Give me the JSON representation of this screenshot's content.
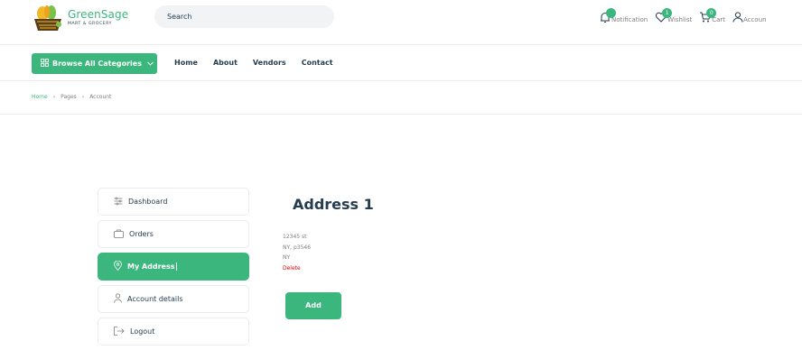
{
  "brand": {
    "name": "GreenSage",
    "tagline": "MART & GROCERY"
  },
  "search": {
    "placeholder": "Search"
  },
  "header_actions": [
    {
      "label": "Notification",
      "icon": "bell-icon"
    },
    {
      "label": "Wishlist",
      "badge": "1",
      "icon": "heart-icon"
    },
    {
      "label": "Cart",
      "badge": "0",
      "icon": "cart-icon"
    },
    {
      "label": "Accoun",
      "icon": "user-icon"
    }
  ],
  "nav": {
    "browse_label": "Browse All Categories",
    "links": [
      "Home",
      "About",
      "Vendors",
      "Contact"
    ]
  },
  "breadcrumb": [
    "Home",
    "Pages",
    "Account"
  ],
  "sidebar": {
    "items": [
      {
        "label": "Dashboard",
        "icon": "sliders-icon"
      },
      {
        "label": "Orders",
        "icon": "bag-icon"
      },
      {
        "label": "My Address",
        "icon": "location-pin-icon",
        "active": true
      },
      {
        "label": "Account details",
        "icon": "user-icon"
      },
      {
        "label": "Logout",
        "icon": "logout-icon"
      }
    ]
  },
  "address": {
    "title": "Address 1",
    "lines": [
      "12345 st",
      "NY, p3546",
      "NY"
    ],
    "delete_label": "Delete",
    "add_label": "Add"
  },
  "colors": {
    "accent": "#3bb77e",
    "text": "#253d4e",
    "muted": "#7e7e7e",
    "danger": "#e10000"
  }
}
